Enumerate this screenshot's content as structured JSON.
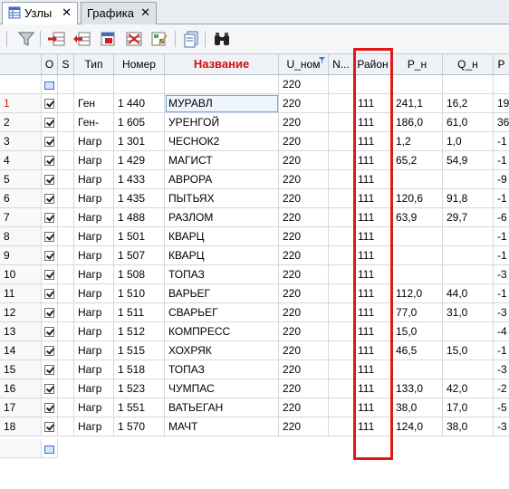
{
  "tabs": [
    {
      "label": "Узлы",
      "close": "✕"
    },
    {
      "label": "Графика",
      "close": "✕"
    }
  ],
  "toolbar": [
    "funnel-icon",
    "insert-row-icon",
    "delete-row-icon",
    "copy-row-icon",
    "delete-rows-icon",
    "edit-icon",
    "document-icon",
    "binoculars-icon"
  ],
  "columns": [
    "",
    "O",
    "S",
    "Тип",
    "Номер",
    "Название",
    "U_ном",
    "N...",
    "Район",
    "P_н",
    "Q_н",
    "P"
  ],
  "filter": {
    "u_nom": "220"
  },
  "rows": [
    {
      "n": "1",
      "type": "Ген",
      "num": "1 440",
      "name": "МУРАВЛ",
      "u": "220",
      "reg": "111",
      "p": "241,1",
      "q": "16,2",
      "pg": "19"
    },
    {
      "n": "2",
      "type": "Ген-",
      "num": "1 605",
      "name": "УРЕНГОЙ",
      "u": "220",
      "reg": "111",
      "p": "186,0",
      "q": "61,0",
      "pg": "36"
    },
    {
      "n": "3",
      "type": "Нагр",
      "num": "1 301",
      "name": "ЧЕСНОК2",
      "u": "220",
      "reg": "111",
      "p": "1,2",
      "q": "1,0",
      "pg": "-1"
    },
    {
      "n": "4",
      "type": "Нагр",
      "num": "1 429",
      "name": "МАГИСТ",
      "u": "220",
      "reg": "111",
      "p": "65,2",
      "q": "54,9",
      "pg": "-1"
    },
    {
      "n": "5",
      "type": "Нагр",
      "num": "1 433",
      "name": "АВРОРА",
      "u": "220",
      "reg": "111",
      "p": "",
      "q": "",
      "pg": "-9"
    },
    {
      "n": "6",
      "type": "Нагр",
      "num": "1 435",
      "name": "ПЫТЬЯХ",
      "u": "220",
      "reg": "111",
      "p": "120,6",
      "q": "91,8",
      "pg": "-1"
    },
    {
      "n": "7",
      "type": "Нагр",
      "num": "1 488",
      "name": "РАЗЛОМ",
      "u": "220",
      "reg": "111",
      "p": "63,9",
      "q": "29,7",
      "pg": "-6"
    },
    {
      "n": "8",
      "type": "Нагр",
      "num": "1 501",
      "name": "КВАРЦ",
      "u": "220",
      "reg": "111",
      "p": "",
      "q": "",
      "pg": "-1"
    },
    {
      "n": "9",
      "type": "Нагр",
      "num": "1 507",
      "name": "КВАРЦ",
      "u": "220",
      "reg": "111",
      "p": "",
      "q": "",
      "pg": "-1"
    },
    {
      "n": "10",
      "type": "Нагр",
      "num": "1 508",
      "name": "ТОПАЗ",
      "u": "220",
      "reg": "111",
      "p": "",
      "q": "",
      "pg": "-3"
    },
    {
      "n": "11",
      "type": "Нагр",
      "num": "1 510",
      "name": "ВАРЬЕГ",
      "u": "220",
      "reg": "111",
      "p": "112,0",
      "q": "44,0",
      "pg": "-1"
    },
    {
      "n": "12",
      "type": "Нагр",
      "num": "1 511",
      "name": "СВАРЬЕГ",
      "u": "220",
      "reg": "111",
      "p": "77,0",
      "q": "31,0",
      "pg": "-3"
    },
    {
      "n": "13",
      "type": "Нагр",
      "num": "1 512",
      "name": "КОМПРЕСС",
      "u": "220",
      "reg": "111",
      "p": "15,0",
      "q": "",
      "pg": "-4"
    },
    {
      "n": "14",
      "type": "Нагр",
      "num": "1 515",
      "name": "ХОХРЯК",
      "u": "220",
      "reg": "111",
      "p": "46,5",
      "q": "15,0",
      "pg": "-1"
    },
    {
      "n": "15",
      "type": "Нагр",
      "num": "1 518",
      "name": "ТОПАЗ",
      "u": "220",
      "reg": "111",
      "p": "",
      "q": "",
      "pg": "-3"
    },
    {
      "n": "16",
      "type": "Нагр",
      "num": "1 523",
      "name": "ЧУМПАС",
      "u": "220",
      "reg": "111",
      "p": "133,0",
      "q": "42,0",
      "pg": "-2"
    },
    {
      "n": "17",
      "type": "Нагр",
      "num": "1 551",
      "name": "ВАТЬЕГАН",
      "u": "220",
      "reg": "111",
      "p": "38,0",
      "q": "17,0",
      "pg": "-5"
    },
    {
      "n": "18",
      "type": "Нагр",
      "num": "1 570",
      "name": "МАЧТ",
      "u": "220",
      "reg": "111",
      "p": "124,0",
      "q": "38,0",
      "pg": "-3"
    }
  ],
  "colors": {
    "accent_red": "#e01818",
    "header_red": "#d01010",
    "selection": "#7aa7e0"
  }
}
